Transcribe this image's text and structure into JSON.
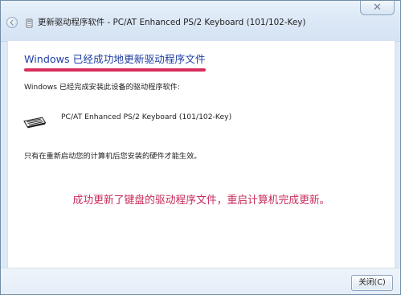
{
  "window": {
    "title": "更新驱动程序软件 - PC/AT Enhanced PS/2 Keyboard (101/102-Key)",
    "close_glyph": "✕"
  },
  "dialog": {
    "heading": "Windows 已经成功地更新驱动程序文件",
    "result_text": "Windows 已经完成安装此设备的驱动程序软件:",
    "device_name": "PC/AT Enhanced PS/2 Keyboard (101/102-Key)",
    "restart_note": "只有在重新启动您的计算机后您安装的硬件才能生效。",
    "annotation": "成功更新了键盘的驱动程序文件，重启计算机完成更新。"
  },
  "footer": {
    "close_button_label": "关闭(C)"
  },
  "icons": {
    "back": "back-arrow-icon",
    "device": "keyboard-icon",
    "title_device": "device-icon",
    "close": "close-icon"
  },
  "colors": {
    "heading": "#1e3ea3",
    "accent_underline": "#d72d5d",
    "annotation": "#c82a59",
    "window_frame": "#dfe9f5"
  }
}
